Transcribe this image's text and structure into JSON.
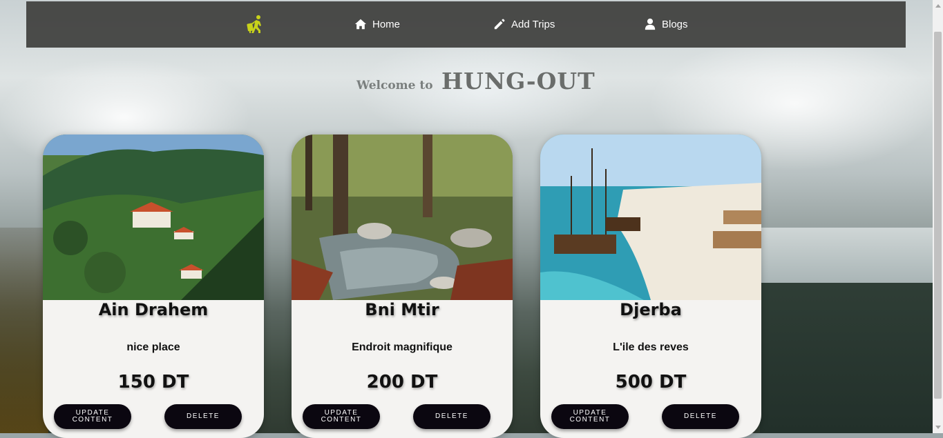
{
  "nav": {
    "logo_icon": "traveler-icon",
    "items": [
      {
        "label": "Home",
        "icon": "home-icon"
      },
      {
        "label": "Add Trips",
        "icon": "pencil-icon"
      },
      {
        "label": "Blogs",
        "icon": "user-icon"
      }
    ],
    "logo_color": "#c8d21a"
  },
  "hero": {
    "welcome": "Welcome to",
    "brand": "HUNG-OUT"
  },
  "cards": [
    {
      "title": "Ain Drahem",
      "description": "nice place",
      "price": "150 DT",
      "update_label": "UPDATE CONTENT",
      "delete_label": "DELETE"
    },
    {
      "title": "Bni Mtir",
      "description": "Endroit magnifique",
      "price": "200 DT",
      "update_label": "UPDATE CONTENT",
      "delete_label": "DELETE"
    },
    {
      "title": "Djerba",
      "description": "L'ile des reves",
      "price": "500 DT",
      "update_label": "UPDATE CONTENT",
      "delete_label": "DELETE"
    }
  ]
}
